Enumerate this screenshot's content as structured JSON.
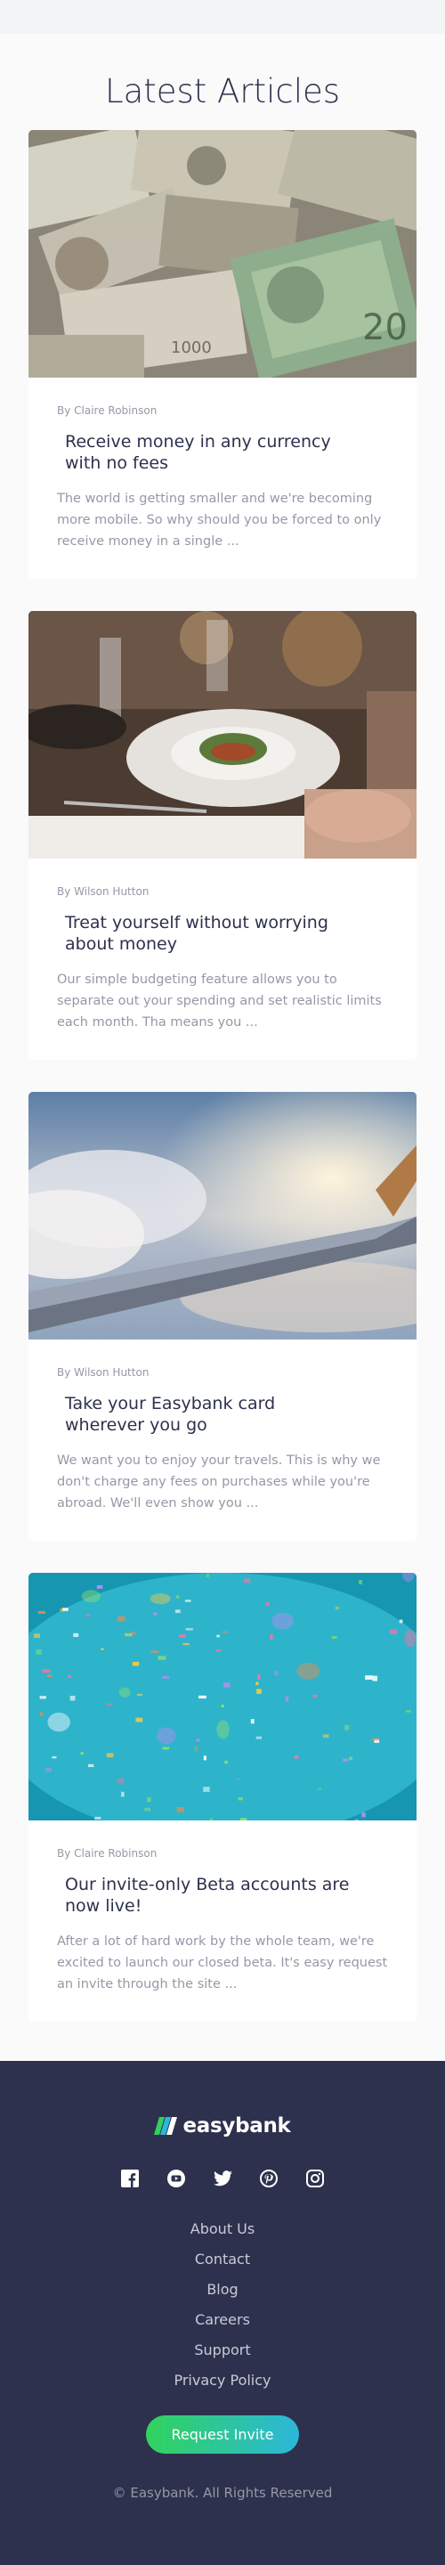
{
  "section_title": "Latest Articles",
  "articles": [
    {
      "author": "By Claire Robinson",
      "title": "Receive money in any currency with no fees",
      "excerpt": "The world is getting smaller and we're becoming more mobile. So why should you be forced to only receive money in a single ..."
    },
    {
      "author": "By Wilson Hutton",
      "title": "Treat yourself without worrying about money",
      "excerpt": "Our simple budgeting feature allows you to separate out your spending and set realistic limits each month. Tha means you ..."
    },
    {
      "author": "By Wilson Hutton",
      "title": "Take your Easybank card wherever you go",
      "excerpt": "We want you to enjoy your travels. This is why we don't charge any fees on purchases while you're abroad. We'll even show you ..."
    },
    {
      "author": "By Claire Robinson",
      "title": "Our invite-only Beta accounts are now live!",
      "excerpt": "After a lot of hard work by the whole team, we're excited to launch our closed beta. It's easy request an invite through the site ..."
    }
  ],
  "footer": {
    "logo_text": "easybank",
    "socials": [
      "facebook-icon",
      "youtube-icon",
      "twitter-icon",
      "pinterest-icon",
      "instagram-icon"
    ],
    "links": [
      "About Us",
      "Contact",
      "Blog",
      "Careers",
      "Support",
      "Privacy Policy"
    ],
    "cta_label": "Request Invite",
    "copyright": "© Easybank. All Rights Reserved"
  },
  "colors": {
    "dark_blue": "#2d314d",
    "lime_green": "#31d35c",
    "bright_cyan": "#2bb7da",
    "grayish_blue": "#9698a6",
    "background": "#fafafa"
  }
}
